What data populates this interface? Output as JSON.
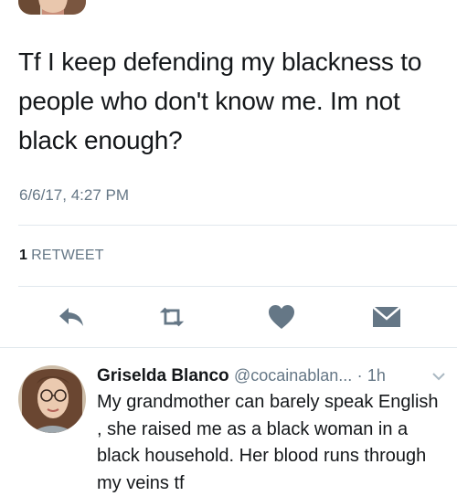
{
  "tweet": {
    "text": "Tf I keep defending my blackness to people who don't know me. Im not black enough?",
    "timestamp": "6/6/17, 4:27 PM",
    "retweet_count": "1",
    "retweet_label": "RETWEET"
  },
  "actions": {
    "icons": [
      "reply-icon",
      "retweet-icon",
      "like-icon",
      "dm-icon"
    ],
    "color": "#657786"
  },
  "reply": {
    "name": "Griselda Blanco",
    "handle": "@cocainablan...",
    "dot": "·",
    "time": "1h",
    "text": "My grandmother can barely speak English , she raised me as a black woman in a black household. Her blood runs through my veins tf"
  },
  "colors": {
    "text": "#14171a",
    "secondary": "#657786",
    "divider": "#e1e8ed"
  }
}
